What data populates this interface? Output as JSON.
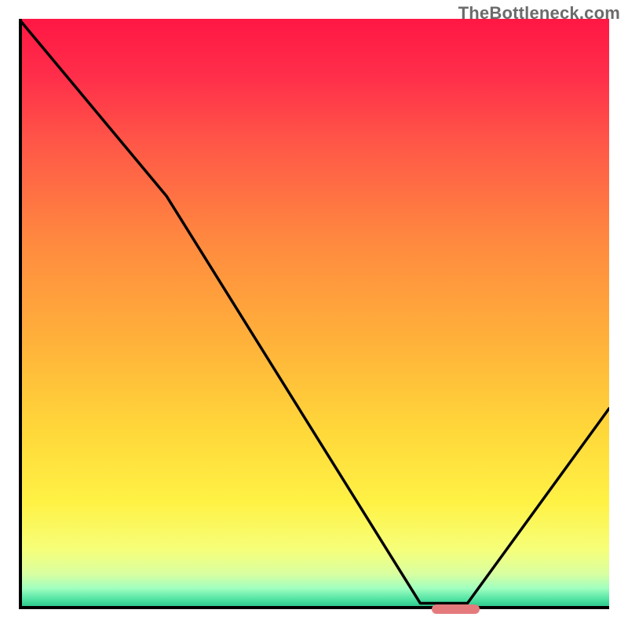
{
  "watermark": {
    "text": "TheBottleneck.com"
  },
  "chart_data": {
    "type": "line",
    "title": "",
    "xlabel": "",
    "ylabel": "",
    "xlim": [
      0,
      100
    ],
    "ylim": [
      0,
      100
    ],
    "x": [
      0,
      25,
      68,
      76,
      100
    ],
    "values": [
      100,
      70,
      1,
      1,
      34
    ],
    "marker": {
      "x_start": 70,
      "x_end": 78,
      "y": 0,
      "color": "#e47a7c"
    },
    "gradient_stops": [
      {
        "pos": 0.0,
        "color": "#ff1744"
      },
      {
        "pos": 0.1,
        "color": "#ff2f4a"
      },
      {
        "pos": 0.22,
        "color": "#ff5a47"
      },
      {
        "pos": 0.38,
        "color": "#ff8a3f"
      },
      {
        "pos": 0.55,
        "color": "#ffb23a"
      },
      {
        "pos": 0.7,
        "color": "#ffd83a"
      },
      {
        "pos": 0.82,
        "color": "#fff245"
      },
      {
        "pos": 0.9,
        "color": "#f6ff7a"
      },
      {
        "pos": 0.94,
        "color": "#d9ffa0"
      },
      {
        "pos": 0.965,
        "color": "#9fffc0"
      },
      {
        "pos": 0.985,
        "color": "#4be0a0"
      },
      {
        "pos": 1.0,
        "color": "#1fbf83"
      }
    ]
  }
}
